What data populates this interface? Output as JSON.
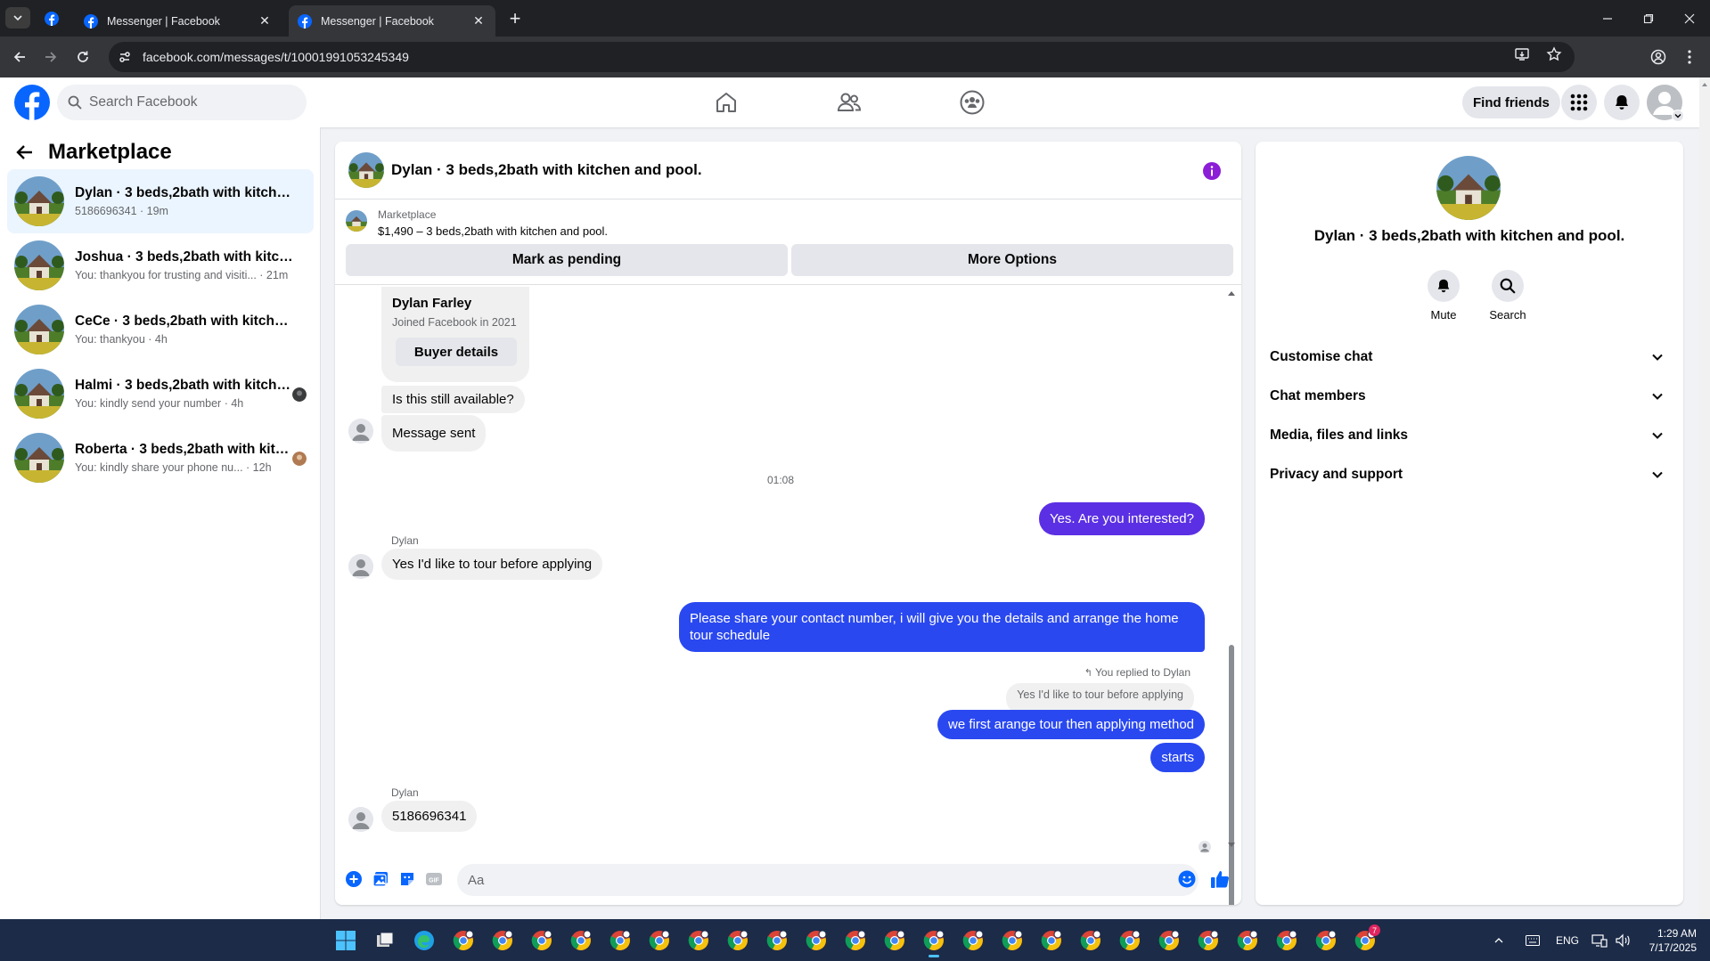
{
  "browser": {
    "tabs": [
      {
        "title": "Messenger | Facebook",
        "active": false
      },
      {
        "title": "Messenger | Facebook",
        "active": true
      }
    ],
    "url": "facebook.com/messages/t/10001991053245349"
  },
  "fb": {
    "search_placeholder": "Search Facebook",
    "find_friends": "Find friends"
  },
  "sidebar": {
    "title": "Marketplace",
    "conversations": [
      {
        "name": "Dylan · 3 beds,2bath with kitchen ...",
        "sub": "5186696341 · 19m",
        "active": true
      },
      {
        "name": "Joshua · 3 beds,2bath with kitchen...",
        "sub": "You: thankyou for trusting and visiti... · 21m"
      },
      {
        "name": "CeCe · 3 beds,2bath with kitchen a...",
        "sub": "You: thankyou · 4h"
      },
      {
        "name": "Halmi · 3 beds,2bath with kitche...",
        "sub": "You: kindly send your number · 4h"
      },
      {
        "name": "Roberta · 3 beds,2bath with kitc...",
        "sub": "You: kindly share your phone nu...  · 12h"
      }
    ]
  },
  "chat": {
    "header_name": "Dylan · 3 beds,2bath with kitchen and pool.",
    "listing_category": "Marketplace",
    "listing_title": "$1,490 – 3 beds,2bath with kitchen and pool.",
    "mark_pending": "Mark as pending",
    "more_options": "More Options",
    "profile_name": "Dylan Farley",
    "profile_joined": "Joined Facebook in 2021",
    "buyer_details": "Buyer details",
    "msg_available": "Is this still available?",
    "msg_sent": "Message sent",
    "timestamp": "01:08",
    "out_1": "Yes. Are you interested?",
    "sender_1": "Dylan",
    "in_1": "Yes I'd like to tour before applying",
    "out_2": "Please share your contact number, i will give you the details and arrange the home tour schedule",
    "replied_label": "You replied to Dylan",
    "quoted": "Yes I'd like to tour before applying",
    "out_3": "we first arange tour then applying method",
    "out_4": "starts",
    "sender_2": "Dylan",
    "in_2": "5186696341",
    "composer_placeholder": "Aa"
  },
  "info_panel": {
    "name": "Dylan · 3 beds,2bath with kitchen and pool.",
    "mute": "Mute",
    "search": "Search",
    "sections": [
      "Customise chat",
      "Chat members",
      "Media, files and links",
      "Privacy and support"
    ]
  },
  "taskbar": {
    "lang": "ENG",
    "time": "1:29 AM",
    "date": "7/17/2025",
    "badge": "7"
  },
  "colors": {
    "fb_blue": "#0866ff",
    "outgoing_purple": "#5b2fe3",
    "outgoing_blue": "#2a48f0",
    "info_purple": "#8b1ed6"
  }
}
